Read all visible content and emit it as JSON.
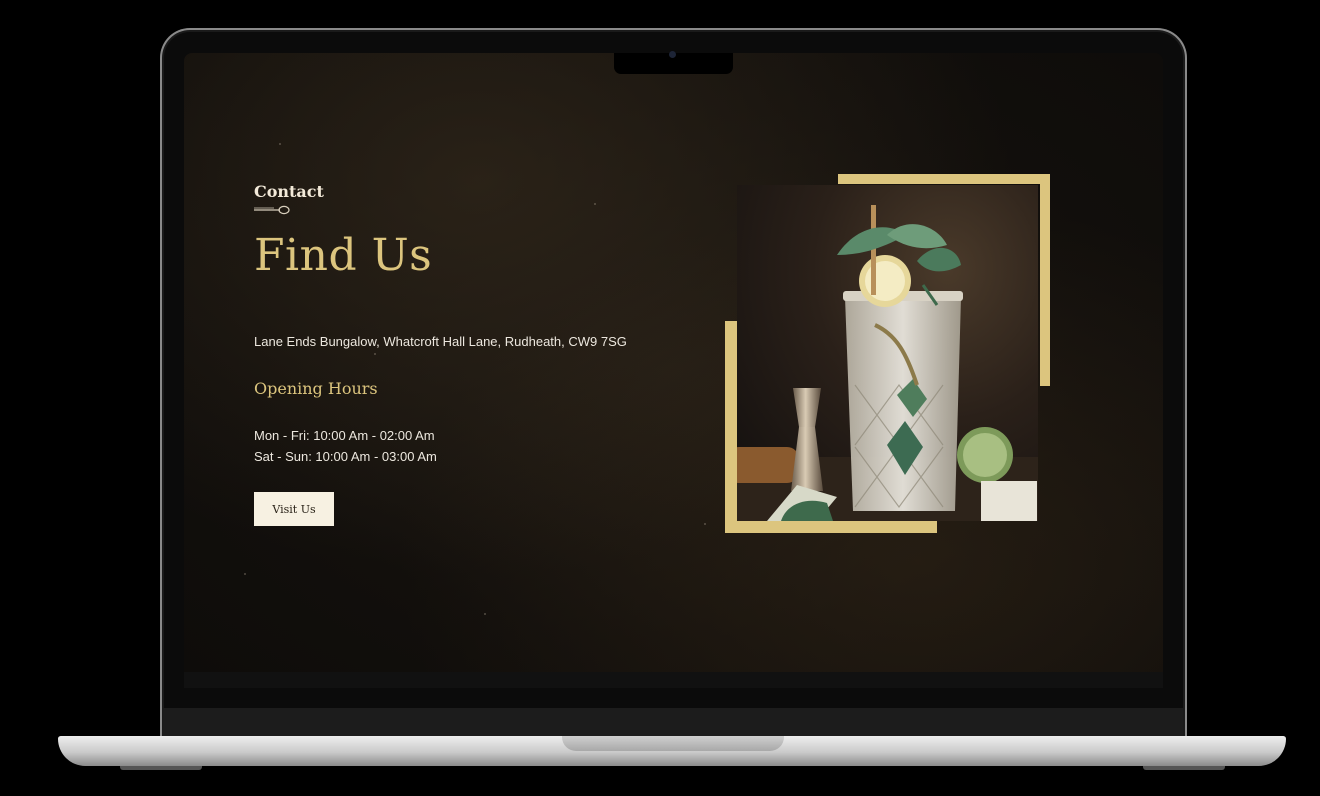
{
  "section": {
    "eyebrow": "Contact",
    "title": "Find Us",
    "address": "Lane Ends Bungalow, Whatcroft Hall Lane, Rudheath, CW9 7SG",
    "hours_heading": "Opening Hours",
    "hours": [
      "Mon - Fri: 10:00 Am - 02:00 Am",
      "Sat - Sun: 10:00 Am - 03:00 Am"
    ],
    "button_label": "Visit Us"
  },
  "image": {
    "icon": "cocktail-glass-photo"
  },
  "colors": {
    "accent_gold": "#dcc57e",
    "background": "#120f0c",
    "text_light": "#ece7de",
    "button_bg": "#f7f1e2"
  }
}
